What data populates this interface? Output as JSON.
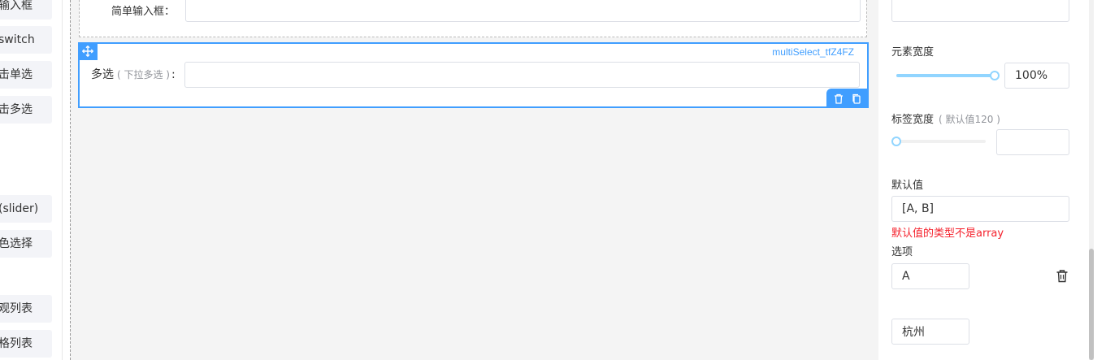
{
  "palette": {
    "items": [
      "输入框",
      "switch",
      "击单选",
      "击多选",
      "(slider)",
      "色选择",
      "观列表",
      "格列表"
    ]
  },
  "canvas": {
    "prev_field_label": "简单输入框：",
    "selected_field": {
      "id": "multiSelect_tfZ4FZ",
      "label": "多选",
      "hint": "( 下拉多选 )",
      "colon": ":"
    }
  },
  "settings": {
    "width_label": "元素宽度",
    "width_value": "100%",
    "width_level": 1.0,
    "label_width_label": "标签宽度",
    "label_width_hint": "( 默认值120 )",
    "label_width_value": "",
    "label_width_level": 0.0,
    "default_label": "默认值",
    "default_value": "[A, B]",
    "default_error": "默认值的类型不是array",
    "options_label": "选项",
    "options": [
      "A",
      "杭州"
    ]
  },
  "colors": {
    "accent": "#409eff",
    "error": "#f5222d",
    "slider_fill": "#91d5ff"
  },
  "icons": [
    "move-icon",
    "trash-icon",
    "copy-icon"
  ]
}
